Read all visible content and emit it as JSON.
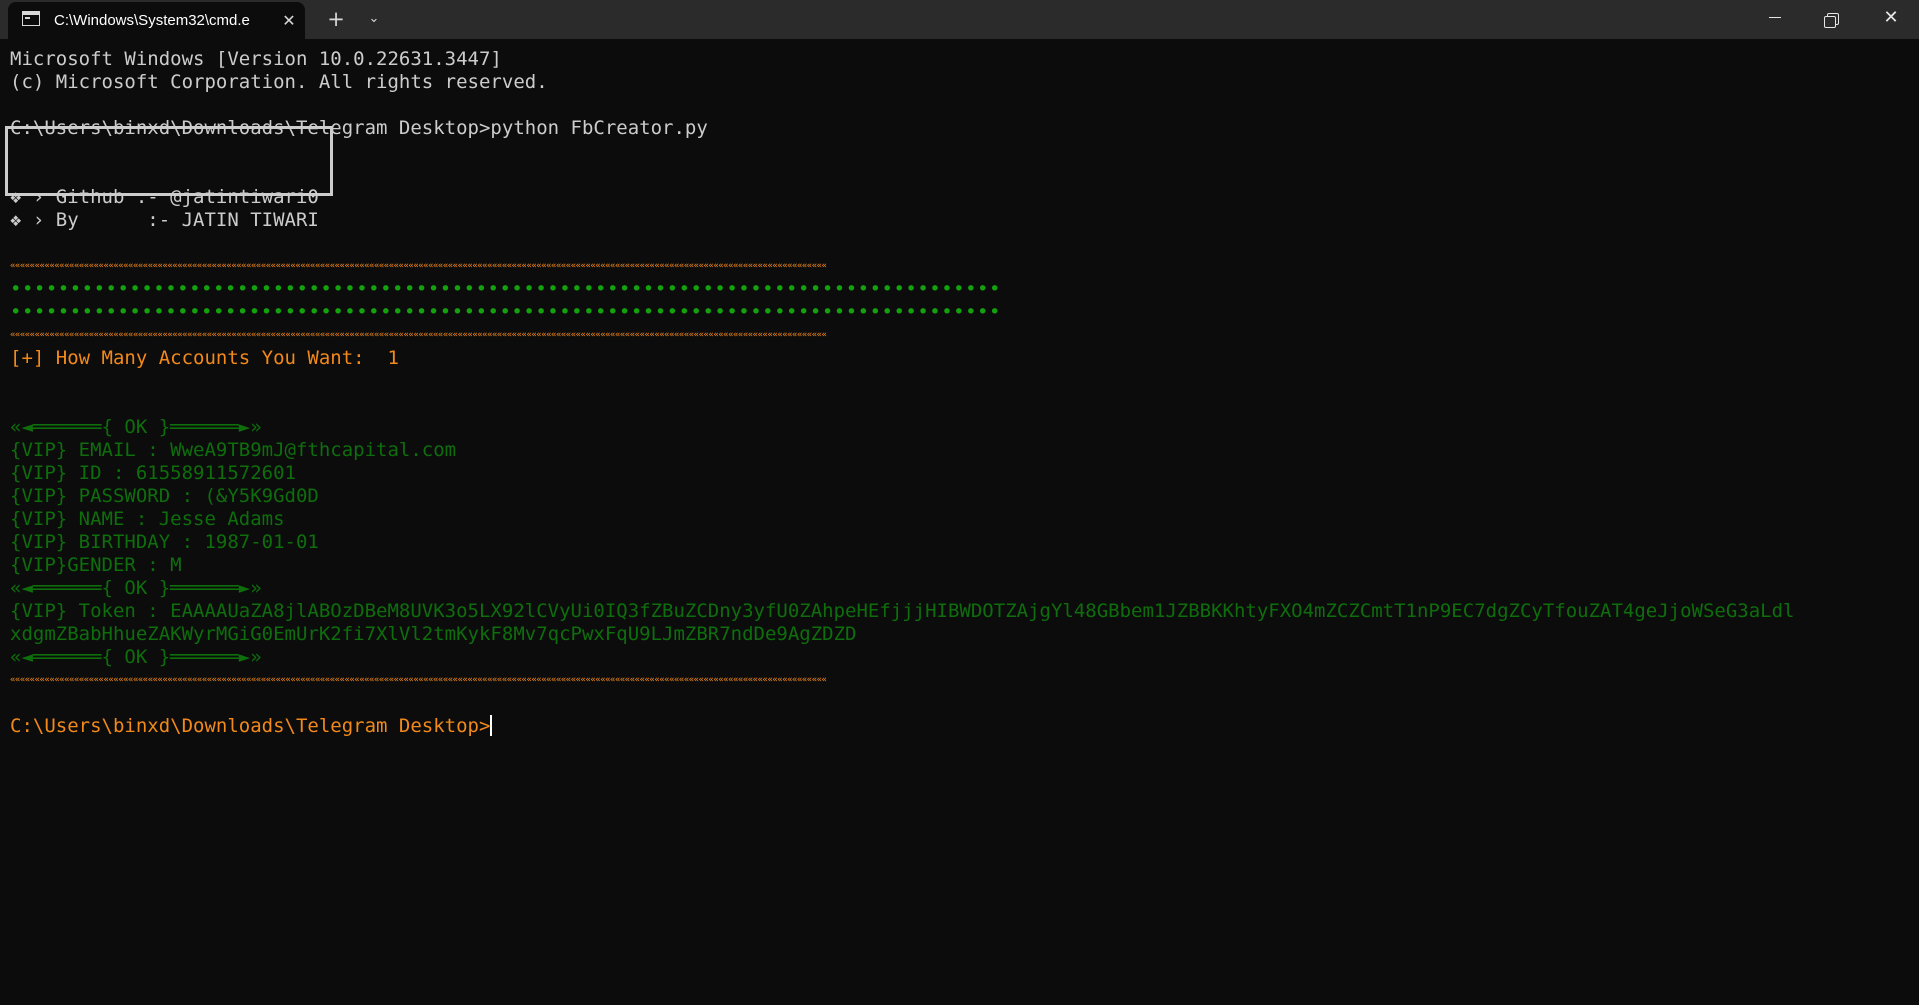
{
  "window": {
    "tab_title": "C:\\Windows\\System32\\cmd.e",
    "tab_close_glyph": "✕",
    "new_tab_glyph": "+",
    "dropdown_glyph": "⌄",
    "minimize_icon": "minimize-icon",
    "maximize_icon": "restore-icon",
    "close_glyph": "✕"
  },
  "colors": {
    "background": "#0c0c0c",
    "titlebar": "#2b2b2b",
    "text": "#cccccc",
    "green": "#13a10e",
    "orange": "#f2891a"
  },
  "console": {
    "header1": "Microsoft Windows [Version 10.0.22631.3447]",
    "header2": "(c) Microsoft Corporation. All rights reserved.",
    "command1": "C:\\Users\\binxd\\Downloads\\Telegram Desktop>python FbCreator.py",
    "banner_line1": "❖ › Github :- @jatintiwari0",
    "banner_line2": "❖ › By      :- JATIN TIWARI",
    "rule": "««««««««««««««««««««««««««««««««««««««««««««««««««««««««««««««««««««««««««««««««««««««««««««««««««««««««««««««««««««««««««««««««««««««««««««««««««««««««««««««««««««««",
    "dots": "•••••••••••••••••••••••••••••••••••••••••••••••••••••••••••••••••••••••••••••••••••",
    "prompt_question": "[+] How Many Accounts You Want:  1",
    "ok_divider": "«◄══════{ OK }══════►»",
    "email": "{VIP} EMAIL : WweA9TB9mJ@fthcapital.com",
    "id": "{VIP} ID : 61558911572601",
    "password": "{VIP} PASSWORD : (&Y5K9Gd0D",
    "name": "{VIP} NAME : Jesse Adams",
    "birthday": "{VIP} BIRTHDAY : 1987-01-01",
    "gender": "{VIP}GENDER : M",
    "token_line1": "{VIP} Token : EAAAAUaZA8jlABOzDBeM8UVK3o5LX92lCVyUi0IQ3fZBuZCDny3yfU0ZAhpeHEfjjjHIBWDOTZAjgYl48GBbem1JZBBKKhtyFXO4mZCZCmtT1nP9EC7dgZCyTfouZAT4geJjoWSeG3aLdl",
    "token_line2": "xdgmZBabHhueZAKWyrMGiG0EmUrK2fi7XlVl2tmKykF8Mv7qcPwxFqU9LJmZBR7ndDe9AgZDZD",
    "final_prompt": "C:\\Users\\binxd\\Downloads\\Telegram Desktop>"
  }
}
